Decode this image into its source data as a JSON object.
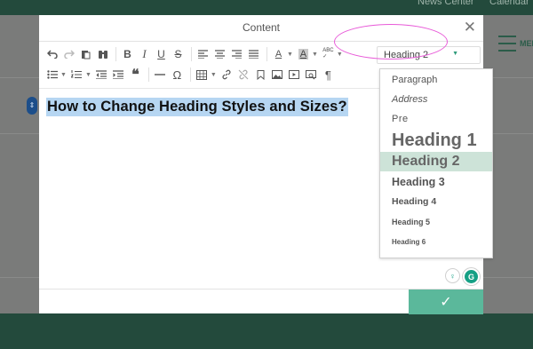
{
  "background": {
    "nav": [
      "News Center",
      "Calendar"
    ],
    "menu_label": "MEN",
    "pin_glyph": "⇕"
  },
  "modal": {
    "title": "Content",
    "close_glyph": "✕",
    "confirm_glyph": "✓"
  },
  "toolbar": {
    "format_value": "Heading 2",
    "format_arrow": "▼"
  },
  "editor": {
    "heading": "How to Change Heading Styles and Sizes?"
  },
  "format_dropdown": {
    "items": [
      "Paragraph",
      "Address",
      "Pre",
      "Heading 1",
      "Heading 2",
      "Heading 3",
      "Heading 4",
      "Heading 5",
      "Heading 6"
    ],
    "selected": "Heading 2"
  },
  "grammarly": {
    "g_label": "G",
    "bulb_glyph": "♀"
  },
  "colors": {
    "accent": "#5bb89b",
    "selection": "#b6d6f2",
    "highlight_ring": "#e85ad8",
    "dropdown_selected": "#cde3d8",
    "background_dark": "#234a3c"
  }
}
